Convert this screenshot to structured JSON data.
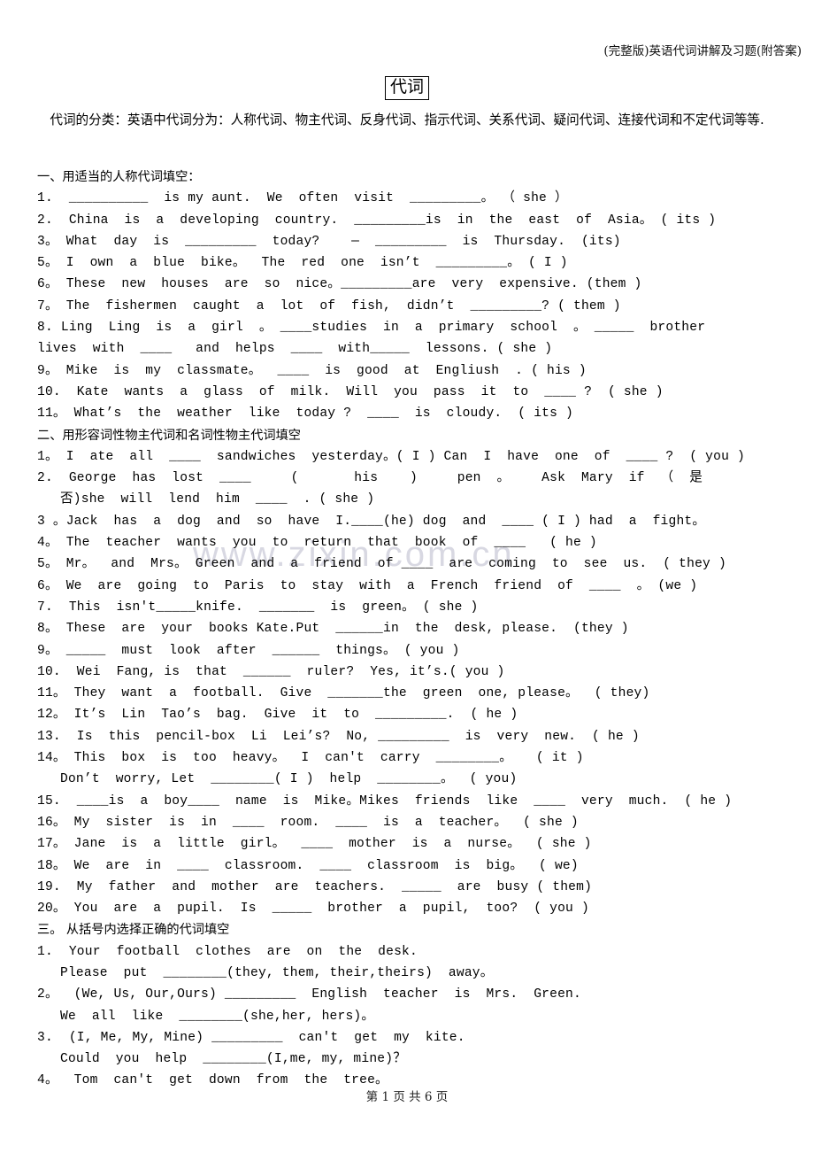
{
  "header": {
    "right_text": "(完整版)英语代词讲解及习题(附答案)"
  },
  "title": "代词",
  "intro": "代词的分类：英语中代词分为：人称代词、物主代词、反身代词、指示代词、关系代词、疑问代词、连接代词和不定代词等等.",
  "watermark": "www.zixin.com.cn",
  "sections": [
    {
      "heading": "一、用适当的人称代词填空：",
      "items": [
        "1.  __________  is my aunt.  We  often  visit  _________。 （ she ）",
        "2.  China  is  a  developing  country.  _________is  in  the  east  of  Asia。 ( its )",
        "3。 What  day  is  _________  today?    —  _________  is  Thursday.  (its)",
        "5。 I  own  a  blue  bike。  The  red  one  isn’t  _________。 ( I )",
        "6。 These  new  houses  are  so  nice。_________are  very  expensive. (them )",
        "7。 The  fishermen  caught  a  lot  of  fish,  didn’t  _________? ( them )",
        "8. Ling  Ling  is  a  girl  。 ____studies  in  a  primary  school  。 _____  brother",
        "lives  with  ____   and  helps  ____  with_____  lessons. ( she )",
        "9。 Mike  is  my  classmate。  ____  is  good  at  Engliush  . ( his )",
        "10.  Kate  wants  a  glass  of  milk.  Will  you  pass  it  to  ____ ?  ( she )",
        "11。 What’s  the  weather  like  today ?  ____  is  cloudy.  ( its )"
      ]
    },
    {
      "heading": "二、用形容词性物主代词和名词性物主代词填空",
      "items": [
        "1。 I  ate  all  ____  sandwiches  yesterday。( I ) Can  I  have  one  of  ____ ?  ( you )",
        "2.  George  has  lost  ____     (       his    )     pen  。    Ask  Mary  if  （  是",
        "否)she  will  lend  him  ____  . ( she )",
        "3 。Jack  has  a  dog  and  so  have  I.____(he) dog  and  ____ ( I ) had  a  fight。",
        "4。 The  teacher  wants  you  to  return  that  book  of  ____   ( he )",
        "5。 Mr。  and  Mrs。 Green  and  a  friend  of ____  are  coming  to  see  us.  ( they )",
        "6。 We  are  going  to  Paris  to  stay  with  a  French  friend  of  ____  。 (we )",
        "7.  This  isn't_____knife.  _______  is  green。 ( she )",
        "8。 These  are  your  books Kate.Put  ______in  the  desk, please.  (they )",
        "9。 _____  must  look  after  ______  things。 ( you )",
        "10.  Wei  Fang, is  that  ______  ruler?  Yes, it’s.( you )",
        "11。 They  want  a  football.  Give  _______the  green  one, please。  ( they)",
        "12。 It’s  Lin  Tao’s  bag.  Give  it  to  _________.  ( he )",
        "13.  Is  this  pencil-box  Li  Lei’s?  No, _________  is  very  new.  ( he )",
        "14。 This  box  is  too  heavy。  I  can't  carry  ________。   ( it )",
        "Don’t  worry, Let  ________( I )  help  ________。  ( you)",
        "15.  ____is  a  boy____  name  is  Mike。Mikes  friends  like  ____  very  much.  ( he )",
        "16。 My  sister  is  in  ____  room.  ____  is  a  teacher。  ( she )",
        "17。 Jane  is  a  little  girl。  ____  mother  is  a  nurse。  ( she )",
        "18。 We  are  in  ____  classroom.  ____  classroom  is  big。  ( we)",
        "19.  My  father  and  mother  are  teachers.  _____  are  busy ( them)",
        "20。 You  are  a  pupil.  Is  _____  brother  a  pupil,  too?  ( you )"
      ]
    },
    {
      "heading": "三。  从括号内选择正确的代词填空",
      "items": [
        "1.  Your  football  clothes  are  on  the  desk.",
        "Please  put  ________(they, them, their,theirs)  away。",
        "2。  (We, Us, Our,Ours) _________  English  teacher  is  Mrs.  Green.",
        "We  all  like  ________(she,her, hers)。",
        "3.  (I, Me, My, Mine) _________  can't  get  my  kite.",
        "Could  you  help  ________(I,me, my, mine)？",
        "4。  Tom  can't  get  down  from  the  tree。"
      ]
    }
  ],
  "footer": "第 1 页 共 6 页"
}
